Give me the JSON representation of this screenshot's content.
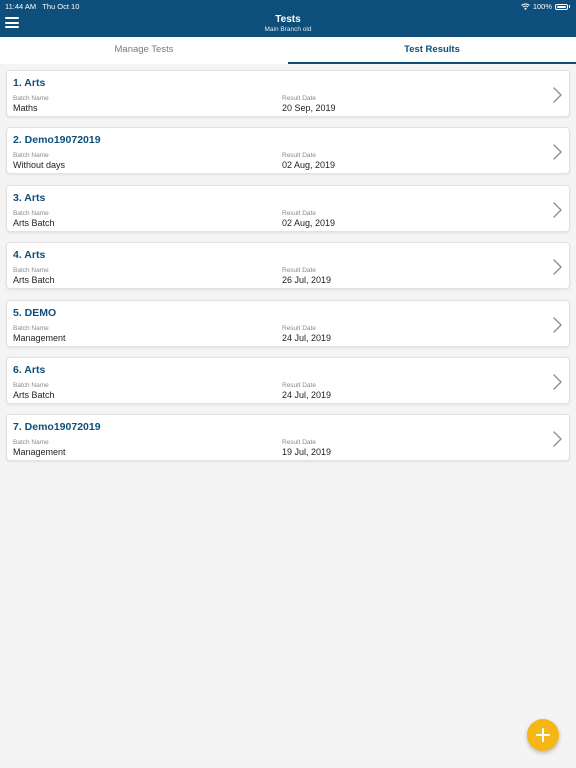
{
  "status_bar": {
    "time": "11:44 AM",
    "date": "Thu Oct 10",
    "battery": "100%",
    "wifi_icon": "wifi-icon"
  },
  "header": {
    "title": "Tests",
    "subtitle": "Main Branch old",
    "menu_icon": "hamburger-menu-icon"
  },
  "tabs": [
    {
      "label": "Manage Tests",
      "active": false
    },
    {
      "label": "Test Results",
      "active": true
    }
  ],
  "labels": {
    "batch": "Batch Name",
    "date": "Result Date"
  },
  "tests": [
    {
      "title": "1. Arts",
      "batch": "Maths",
      "date": "20 Sep, 2019"
    },
    {
      "title": "2. Demo19072019",
      "batch": "Without days",
      "date": "02 Aug, 2019"
    },
    {
      "title": "3. Arts",
      "batch": "Arts Batch",
      "date": "02 Aug, 2019"
    },
    {
      "title": "4. Arts",
      "batch": "Arts Batch",
      "date": "26 Jul, 2019"
    },
    {
      "title": "5. DEMO",
      "batch": "Management",
      "date": "24 Jul, 2019"
    },
    {
      "title": "6. Arts",
      "batch": "Arts Batch",
      "date": "24 Jul, 2019"
    },
    {
      "title": "7. Demo19072019",
      "batch": "Management",
      "date": "19 Jul, 2019"
    }
  ],
  "fab": {
    "icon": "plus-icon",
    "color": "#f5b716"
  },
  "colors": {
    "primary": "#0d4f7a",
    "background": "#f4f4f4"
  }
}
